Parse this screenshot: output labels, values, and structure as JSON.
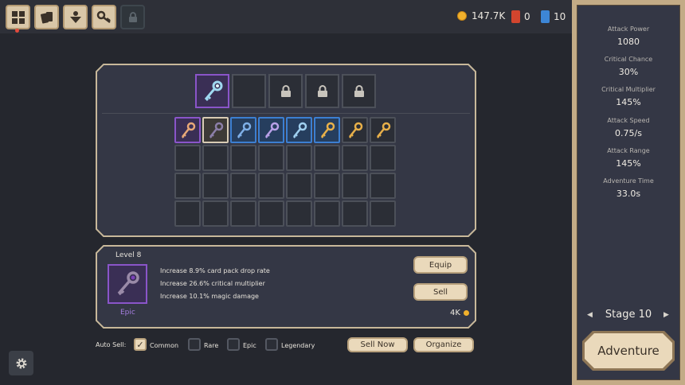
{
  "toolbar": {
    "icons": [
      "grid-icon",
      "cards-icon",
      "upgrade-icon",
      "key-icon",
      "lock-icon"
    ]
  },
  "resources": {
    "gold": "147.7K",
    "red_cards": "0",
    "blue_cards": "10"
  },
  "inventory": {
    "equipped": [
      {
        "rarity": "epic",
        "icon": "key-icon"
      },
      {
        "state": "empty"
      },
      {
        "state": "locked"
      },
      {
        "state": "locked"
      },
      {
        "state": "locked"
      }
    ],
    "items": [
      {
        "rarity": "epic",
        "color": "#8a55c9",
        "icon": "key-icon"
      },
      {
        "rarity": "common",
        "color": "#d8cbb4",
        "icon": "key-icon"
      },
      {
        "rarity": "rare",
        "color": "#3c7fd1",
        "icon": "key-icon"
      },
      {
        "rarity": "rare",
        "color": "#3c7fd1",
        "icon": "key-icon"
      },
      {
        "rarity": "rare",
        "color": "#3c7fd1",
        "icon": "key-icon"
      },
      {
        "rarity": "rare",
        "color": "#3c7fd1",
        "icon": "key-icon"
      },
      {
        "rarity": "none",
        "color": "#4c5059",
        "icon": "key-icon"
      },
      {
        "rarity": "none",
        "color": "#4c5059",
        "icon": "key-icon"
      }
    ]
  },
  "detail": {
    "level": "Level 8",
    "rarity": "Epic",
    "stats": [
      "Increase 8.9% card pack drop rate",
      "Increase 26.6% critical multiplier",
      "Increase 10.1% magic damage"
    ],
    "equip_label": "Equip",
    "sell_label": "Sell",
    "price": "4K"
  },
  "autosell": {
    "label": "Auto Sell:",
    "options": [
      {
        "label": "Common",
        "checked": true
      },
      {
        "label": "Rare",
        "checked": false
      },
      {
        "label": "Epic",
        "checked": false
      },
      {
        "label": "Legendary",
        "checked": false
      }
    ],
    "sell_now_label": "Sell Now",
    "organize_label": "Organize"
  },
  "stats_panel": [
    {
      "name": "Attack Power",
      "value": "1080"
    },
    {
      "name": "Critical Chance",
      "value": "30%"
    },
    {
      "name": "Critical Multiplier",
      "value": "145%"
    },
    {
      "name": "Attack Speed",
      "value": "0.75/s"
    },
    {
      "name": "Attack Range",
      "value": "145%"
    },
    {
      "name": "Adventure Time",
      "value": "33.0s"
    }
  ],
  "stage": {
    "label": "Stage 10"
  },
  "adventure_label": "Adventure",
  "colors": {
    "accent": "#ead9bb",
    "epic": "#8a55c9",
    "rare": "#3c7fd1",
    "gold": "#f0b02c"
  }
}
